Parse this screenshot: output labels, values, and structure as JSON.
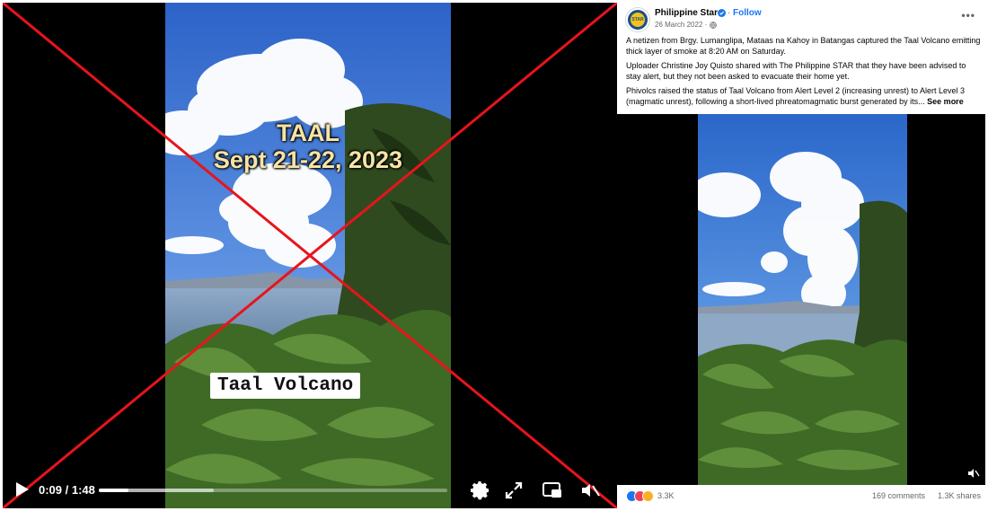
{
  "left_video": {
    "overlay_title_line1": "TAAL",
    "overlay_title_line2": "Sept 21-22, 2023",
    "overlay_label": "Taal Volcano",
    "time_display": "0:09 / 1:48",
    "progress": 0.085,
    "buffered": 0.33,
    "cross_color": "#e8141b",
    "controls": {
      "play_icon": "play-icon",
      "settings_icon": "gear-icon",
      "fullscreen_icon": "expand-icon",
      "pip_icon": "picture-in-picture-icon",
      "mute_icon": "volume-muted-icon"
    }
  },
  "post": {
    "page_name": "Philippine Star",
    "verified_icon": "verified-badge-icon",
    "separator": "·",
    "follow_label": "Follow",
    "date": "26 March 2022 ·",
    "privacy_icon": "globe-icon",
    "more_icon": "more-options-icon",
    "paragraphs": [
      "A netizen from Brgy. Lumanglipa, Mataas na Kahoy in Batangas captured the Taal Volcano emitting thick layer of smoke at 8:20 AM on Saturday.",
      "Uploader Christine Joy Quisto shared with The Philippine STAR that they have been advised to stay alert, but they not been asked to evacuate their home yet.",
      "Phivolcs raised the status of Taal Volcano from Alert Level 2 (increasing unrest) to Alert Level 3 (magmatic unrest), following a short-lived phreatomagmatic burst generated by its..."
    ],
    "see_more": "See more",
    "video_mute_icon": "volume-muted-icon",
    "reactions_count": "3.3K",
    "comments_count": "169 comments",
    "shares_count": "1.3K shares",
    "reaction_icons": [
      "like-icon",
      "love-icon",
      "wow-icon"
    ],
    "accent_color": "#1877f2",
    "avatar_text": "STAR"
  }
}
